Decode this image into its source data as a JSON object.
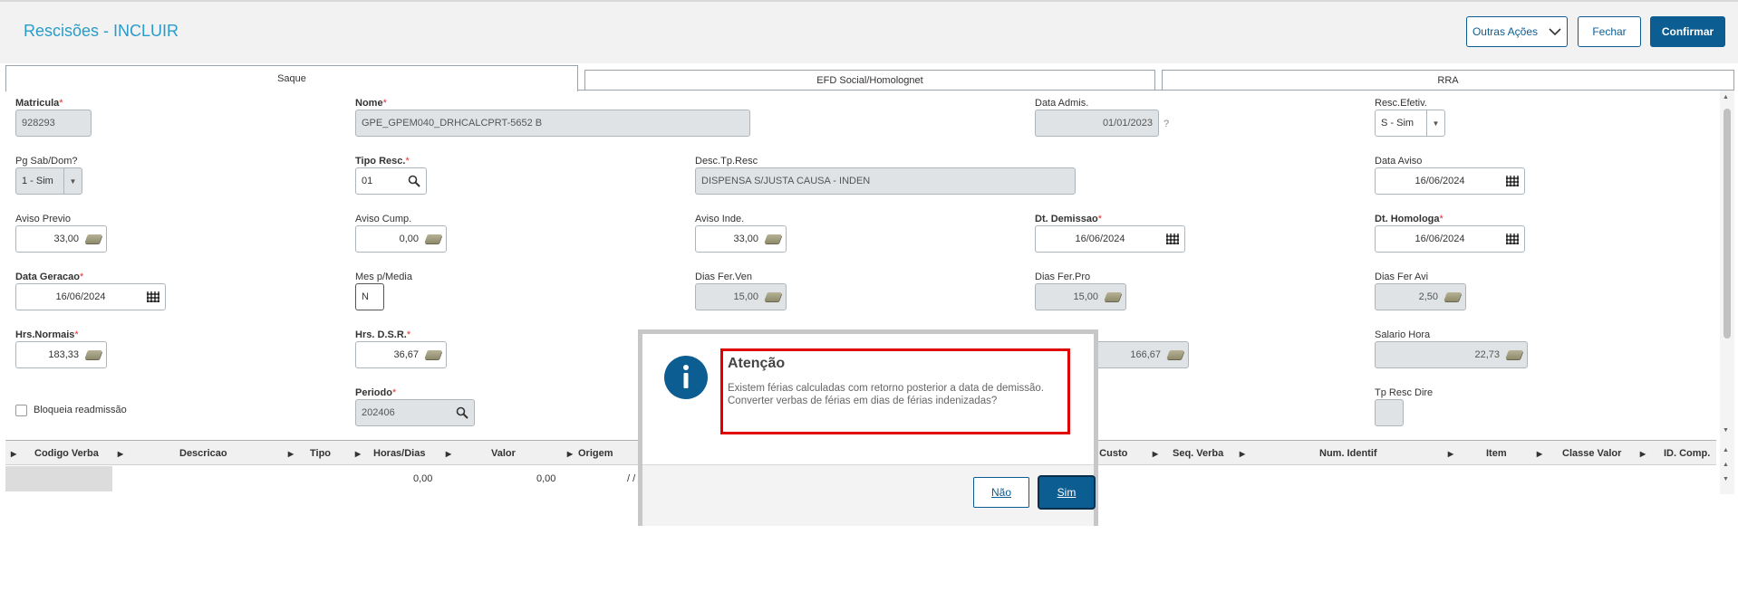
{
  "header": {
    "title": "Rescisões - INCLUIR",
    "more_actions": "Outras Ações",
    "close": "Fechar",
    "confirm": "Confirmar"
  },
  "tabs": [
    "Saque",
    "EFD Social/Homolognet",
    "RRA"
  ],
  "fields": {
    "matricula": {
      "label": "Matricula",
      "value": "928293"
    },
    "nome": {
      "label": "Nome",
      "value": "GPE_GPEM040_DRHCALCPRT-5652 B"
    },
    "data_admis": {
      "label": "Data Admis.",
      "value": "01/01/2023",
      "help": "?"
    },
    "resc_efetiv": {
      "label": "Resc.Efetiv.",
      "value": "S - Sim"
    },
    "pg_sab_dom": {
      "label": "Pg Sab/Dom?",
      "value": "1 - Sim"
    },
    "tipo_resc": {
      "label": "Tipo Resc.",
      "value": "01"
    },
    "desc_tp_resc": {
      "label": "Desc.Tp.Resc",
      "value": "DISPENSA S/JUSTA CAUSA - INDEN"
    },
    "data_aviso": {
      "label": "Data Aviso",
      "value": "16/06/2024"
    },
    "aviso_previo": {
      "label": "Aviso Previo",
      "value": "33,00"
    },
    "aviso_cump": {
      "label": "Aviso Cump.",
      "value": "0,00"
    },
    "aviso_inde": {
      "label": "Aviso Inde.",
      "value": "33,00"
    },
    "dt_demissao": {
      "label": "Dt. Demissao",
      "value": "16/06/2024"
    },
    "dt_homologa": {
      "label": "Dt. Homologa",
      "value": "16/06/2024"
    },
    "data_geracao": {
      "label": "Data Geracao",
      "value": "16/06/2024"
    },
    "mes_p_media": {
      "label": "Mes p/Media",
      "value": "N"
    },
    "dias_fer_ven": {
      "label": "Dias Fer.Ven",
      "value": "15,00"
    },
    "dias_fer_pro": {
      "label": "Dias Fer.Pro",
      "value": "15,00"
    },
    "dias_fer_avi": {
      "label": "Dias Fer Avi",
      "value": "2,50"
    },
    "hrs_normais": {
      "label": "Hrs.Normais",
      "value": "183,33"
    },
    "hrs_dsr": {
      "label": "Hrs. D.S.R.",
      "value": "36,67"
    },
    "hidden_value": {
      "value": "166,67"
    },
    "salario_hora": {
      "label": "Salario Hora",
      "value": "22,73"
    },
    "bloqueia": {
      "label": "Bloqueia readmissão"
    },
    "periodo": {
      "label": "Periodo",
      "value": "202406"
    },
    "tp_resc_dire": {
      "label": "Tp Resc Dire"
    }
  },
  "grid": {
    "columns": [
      "Codigo Verba",
      "Descricao",
      "Tipo",
      "Horas/Dias",
      "Valor",
      "Origem",
      "e Custo",
      "Seq. Verba",
      "Num. Identif",
      "Item",
      "Classe Valor",
      "ID. Comp."
    ],
    "row": {
      "horas": "0,00",
      "valor": "0,00",
      "origem": "/  /"
    }
  },
  "dialog": {
    "title": "Atenção",
    "message1": "Existem férias calculadas com retorno posterior a data de demissão.",
    "message2": "Converter verbas de férias em dias de férias indenizadas?",
    "no": "Não",
    "yes": "Sim",
    "info_icon": "info-icon"
  },
  "colors": {
    "accent": "#0c5d91",
    "title": "#2a9cc8",
    "required": "#e03030",
    "highlight": "#e00000"
  }
}
